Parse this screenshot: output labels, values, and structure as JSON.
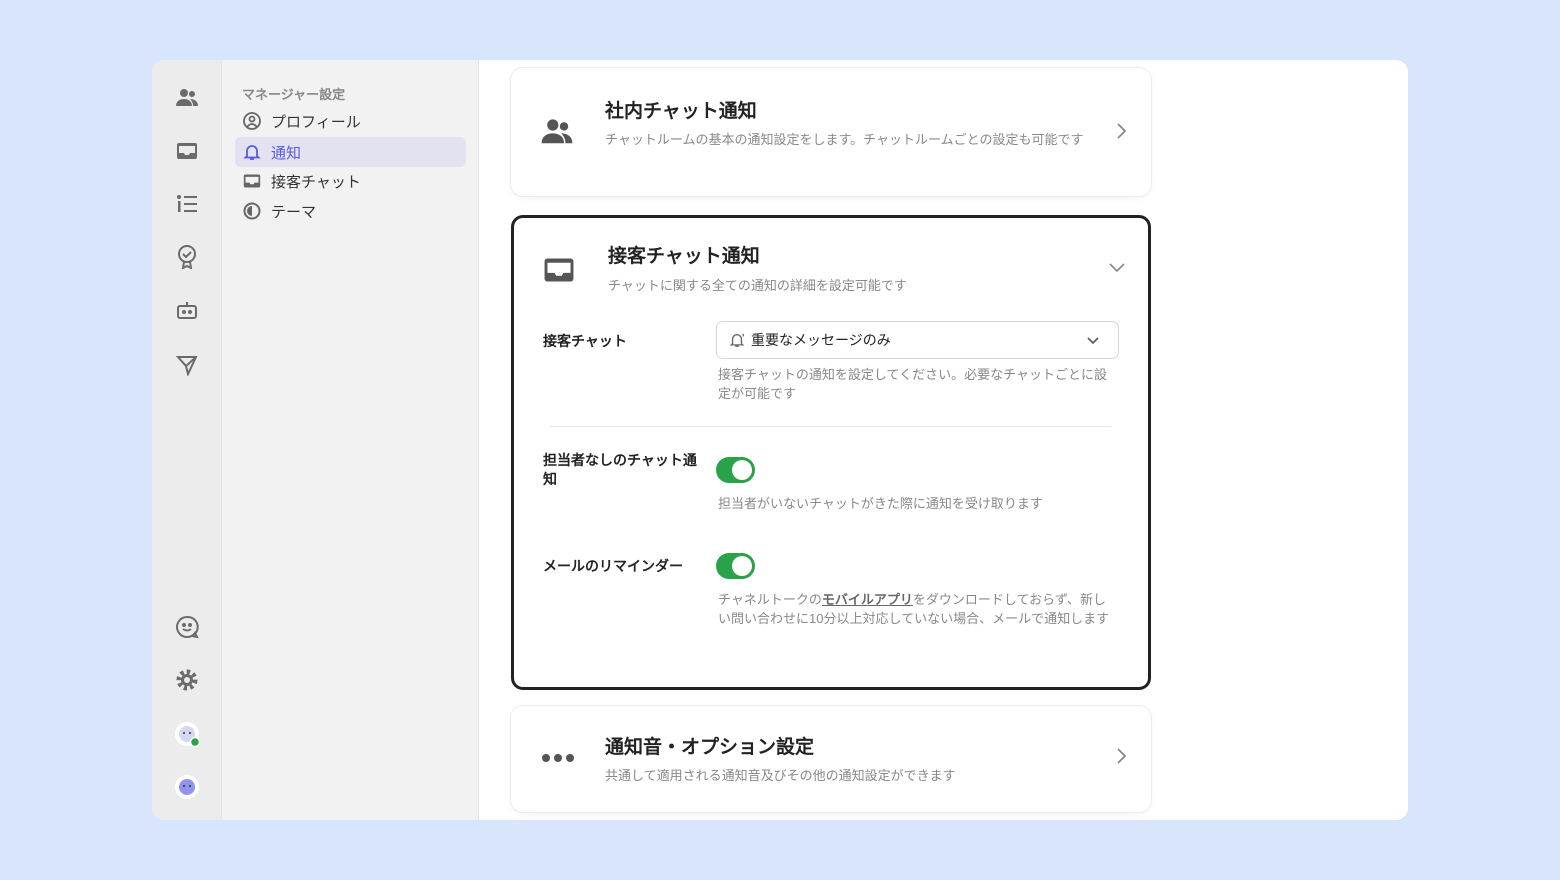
{
  "sidebar": {
    "header": "マネージャー設定",
    "items": [
      {
        "label": "プロフィール",
        "icon": "user-circle-icon"
      },
      {
        "label": "通知",
        "icon": "bell-icon",
        "active": true
      },
      {
        "label": "接客チャット",
        "icon": "inbox-icon"
      },
      {
        "label": "テーマ",
        "icon": "theme-icon"
      }
    ]
  },
  "cards": {
    "team_chat": {
      "title": "社内チャット通知",
      "desc": "チャットルームの基本の通知設定をします。チャットルームごとの設定も可能です"
    },
    "customer_chat": {
      "title": "接客チャット通知",
      "desc": "チャットに関する全ての通知の詳細を設定可能です",
      "chat": {
        "label": "接客チャット",
        "value": "重要なメッセージのみ",
        "help": "接客チャットの通知を設定してください。必要なチャットごとに設定が可能です"
      },
      "unassigned": {
        "label": "担当者なしのチャット通知",
        "on": true,
        "help": "担当者がいないチャットがきた際に通知を受け取ります"
      },
      "reminder": {
        "label": "メールのリマインダー",
        "on": true,
        "help_pre": "チャネルトークの",
        "help_link": "モバイルアプリ",
        "help_post": "をダウンロードしておらず、新しい問い合わせに10分以上対応していない場合、メールで通知します"
      }
    },
    "sound": {
      "title": "通知音・オプション設定",
      "desc": "共通して適用される通知音及びその他の通知設定ができます"
    }
  },
  "colors": {
    "accent": "#5a5ae0",
    "toggle_on": "#2aa24a",
    "background": "#d8e5fd"
  }
}
